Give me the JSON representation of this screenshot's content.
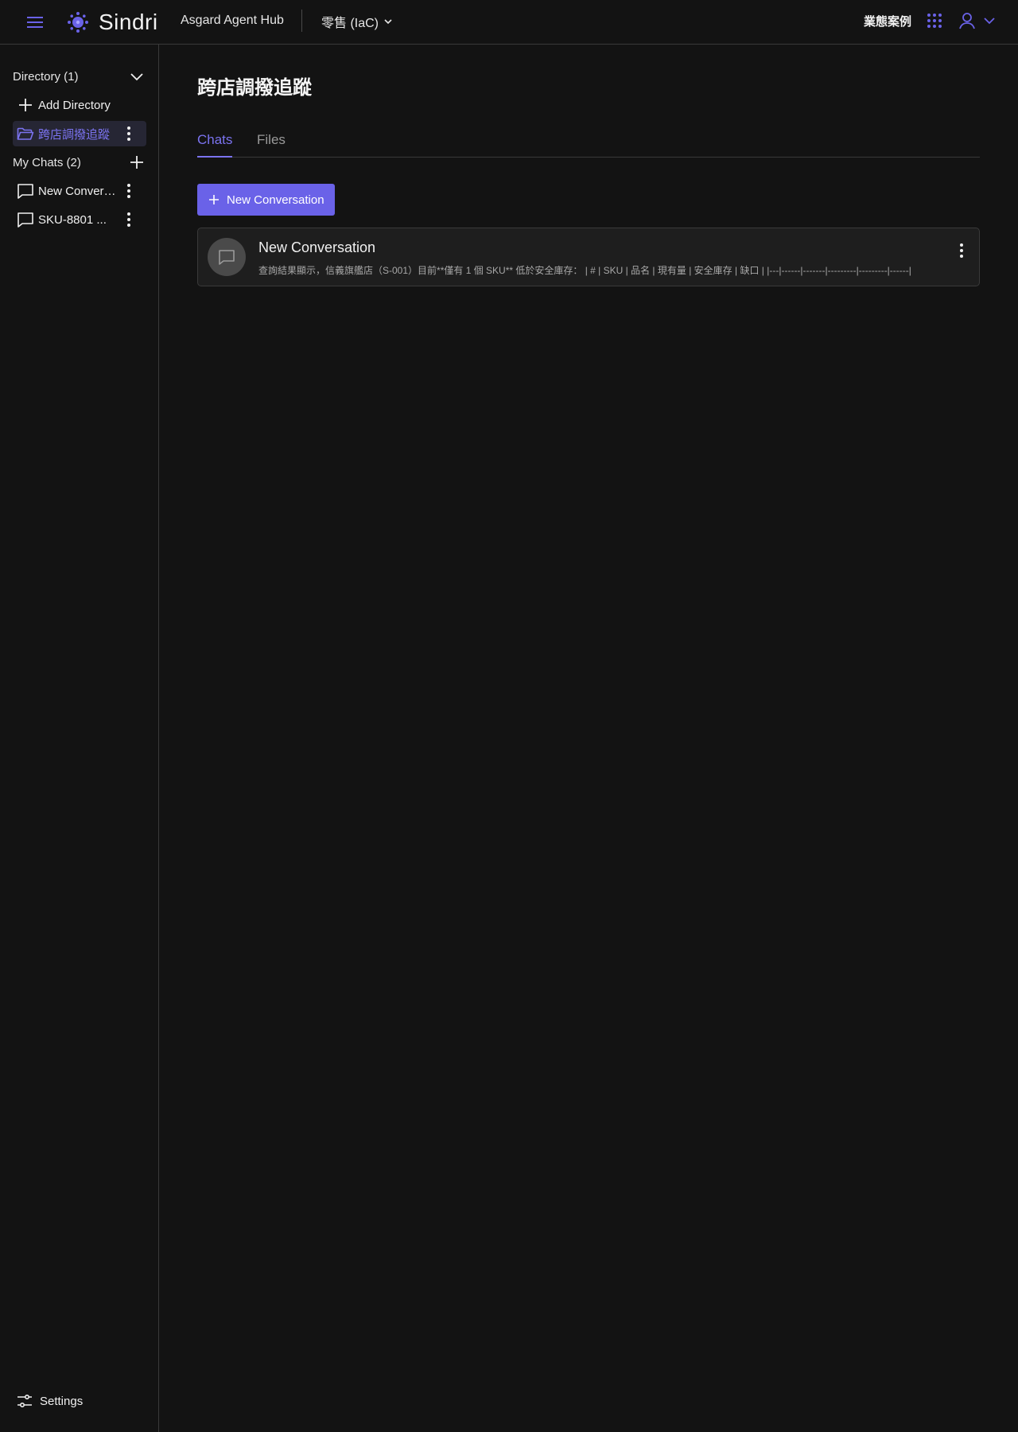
{
  "header": {
    "logo_text": "Sindri",
    "hub_title": "Asgard Agent Hub",
    "workspace": "零售 (IaC)",
    "top_link": "業態案例"
  },
  "sidebar": {
    "directory_label": "Directory (1)",
    "add_directory_label": "Add Directory",
    "directories": [
      {
        "label": "跨店調撥追蹤",
        "active": true
      }
    ],
    "my_chats_label": "My Chats (2)",
    "chats": [
      {
        "label": "New Conversation"
      },
      {
        "label": "SKU-8801 ..."
      }
    ],
    "settings_label": "Settings"
  },
  "main": {
    "title": "跨店調撥追蹤",
    "tabs": [
      {
        "label": "Chats",
        "active": true
      },
      {
        "label": "Files",
        "active": false
      }
    ],
    "new_conversation_label": "New Conversation",
    "conversations": [
      {
        "title": "New Conversation",
        "preview": "查詢結果顯示，信義旗艦店（S-001）目前**僅有 1 個 SKU** 低於安全庫存： | # | SKU | 品名 | 現有量 | 安全庫存 | 缺口 | |---|------|-------|---------|---------|------|"
      }
    ]
  },
  "colors": {
    "accent": "#6a62e8",
    "accent_text": "#7b73f0",
    "background": "#131313",
    "card": "#1e1e1e"
  }
}
